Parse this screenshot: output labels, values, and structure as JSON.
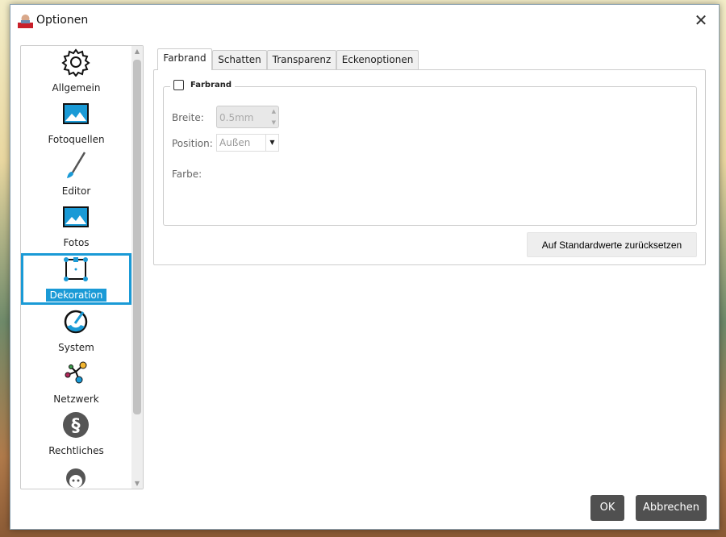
{
  "window": {
    "title": "Optionen",
    "close_icon": "close-icon"
  },
  "sidebar": {
    "items": [
      {
        "label": "Allgemein",
        "icon": "gear-icon"
      },
      {
        "label": "Fotoquellen",
        "icon": "image-icon"
      },
      {
        "label": "Editor",
        "icon": "brush-icon"
      },
      {
        "label": "Fotos",
        "icon": "image-icon"
      },
      {
        "label": "Dekoration",
        "icon": "decoration-frame-icon",
        "selected": true
      },
      {
        "label": "System",
        "icon": "gauge-icon"
      },
      {
        "label": "Netzwerk",
        "icon": "network-icon"
      },
      {
        "label": "Rechtliches",
        "icon": "paragraph-icon"
      },
      {
        "label": "",
        "icon": "support-headset-icon"
      }
    ]
  },
  "tabs": [
    {
      "label": "Farbrand",
      "active": true
    },
    {
      "label": "Schatten"
    },
    {
      "label": "Transparenz"
    },
    {
      "label": "Eckenoptionen"
    }
  ],
  "farbrand": {
    "group_label": "Farbrand",
    "checked": false,
    "width_label": "Breite:",
    "width_value": "0.5mm",
    "position_label": "Position:",
    "position_value": "Außen",
    "color_label": "Farbe:",
    "reset_label": "Auf Standardwerte zurücksetzen"
  },
  "footer": {
    "ok_label": "OK",
    "cancel_label": "Abbrechen"
  },
  "colors": {
    "accent": "#1a9ad6",
    "button_dark": "#505050"
  }
}
